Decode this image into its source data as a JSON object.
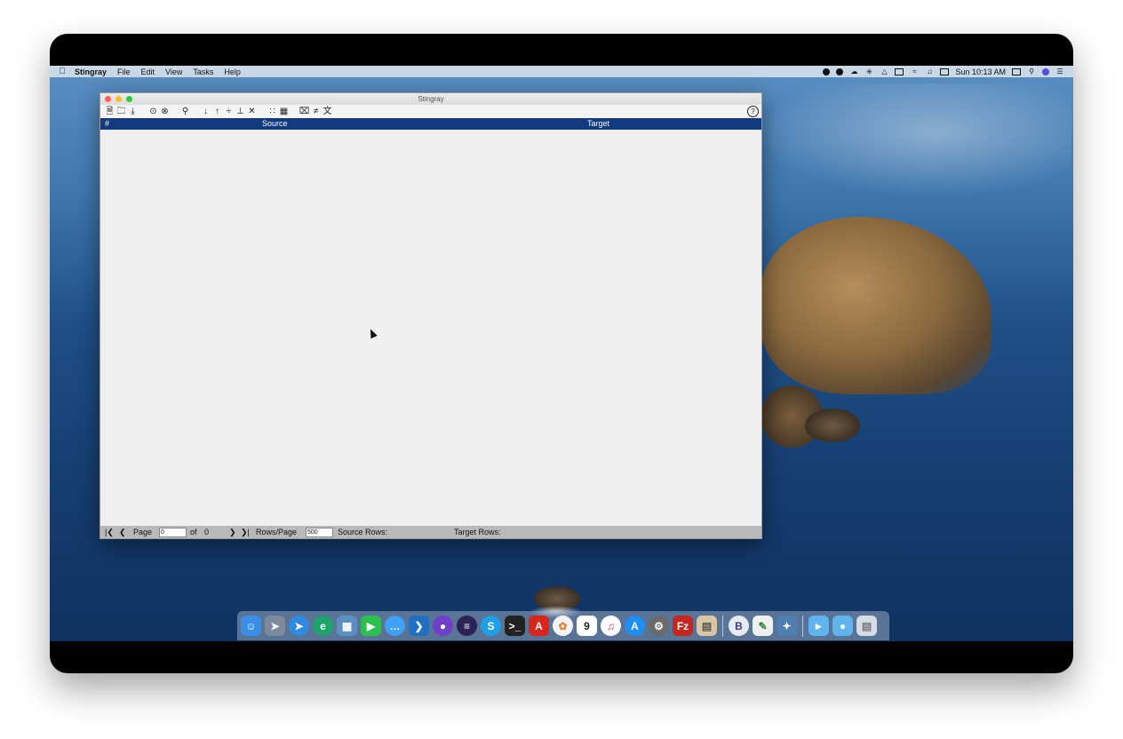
{
  "menubar": {
    "app_name": "Stingray",
    "items": [
      "File",
      "Edit",
      "View",
      "Tasks",
      "Help"
    ],
    "clock": "Sun 10:13 AM"
  },
  "window": {
    "title": "Stingray",
    "columns": {
      "number": "#",
      "source": "Source",
      "target": "Target"
    },
    "toolbar_icons": [
      "new-file-icon",
      "open-folder-icon",
      "download-icon",
      "confirm-icon",
      "unconfirm-icon",
      "search-icon",
      "move-down-icon",
      "move-up-icon",
      "split-icon",
      "merge-icon",
      "delete-icon",
      "grid-small-icon",
      "grid-large-icon",
      "clear-icon",
      "not-equal-icon",
      "translate-icon",
      "help-icon"
    ]
  },
  "statusbar": {
    "page_label": "Page",
    "page_value": "0",
    "of_label": "of",
    "total_pages": "0",
    "rows_per_page_label": "Rows/Page",
    "rows_per_page_value": "500",
    "source_rows_label": "Source Rows:",
    "target_rows_label": "Target Rows:"
  },
  "dock": {
    "apps": [
      "Finder",
      "Launchpad",
      "Safari",
      "Edge",
      "Preview",
      "FaceTime",
      "Messages",
      "VS Code",
      "GitHub",
      "Eclipse",
      "Skype",
      "Terminal",
      "Acrobat",
      "Photos",
      "Calendar",
      "Music",
      "App Store",
      "System Preferences",
      "FileZilla",
      "Notes",
      "BBEdit",
      "Pencil",
      "Swift",
      "Folder",
      "Folder 2",
      "Trash"
    ],
    "calendar_day": "9"
  },
  "colors": {
    "header_bg": "#123a7e",
    "menubar_bg": "#c9d8e6"
  }
}
